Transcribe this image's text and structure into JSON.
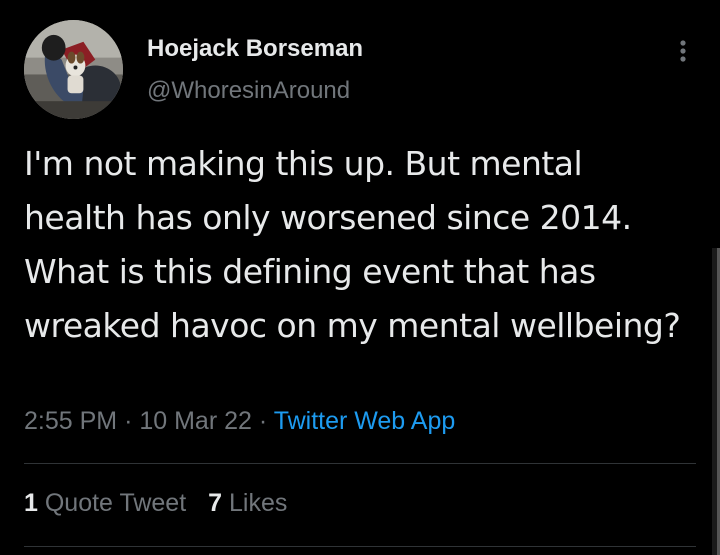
{
  "author": {
    "display_name": "Hoejack Borseman",
    "handle": "@WhoresinAround"
  },
  "tweet": {
    "text": "I'm not making this up. But mental health has only worsened since 2014. What is this defining event that has wreaked havoc on my mental wellbeing?",
    "time": "2:55 PM",
    "separator": "·",
    "date": "10 Mar 22",
    "source": "Twitter Web App"
  },
  "stats": {
    "quote_count": "1",
    "quote_label": "Quote Tweet",
    "like_count": "7",
    "like_label": "Likes"
  },
  "icons": {
    "more": "more-vertical-icon",
    "avatar": "profile-photo"
  },
  "colors": {
    "background": "#000000",
    "text_primary": "#e7e9ea",
    "text_secondary": "#71767b",
    "link": "#1d9bf0",
    "divider": "#2f3336"
  }
}
